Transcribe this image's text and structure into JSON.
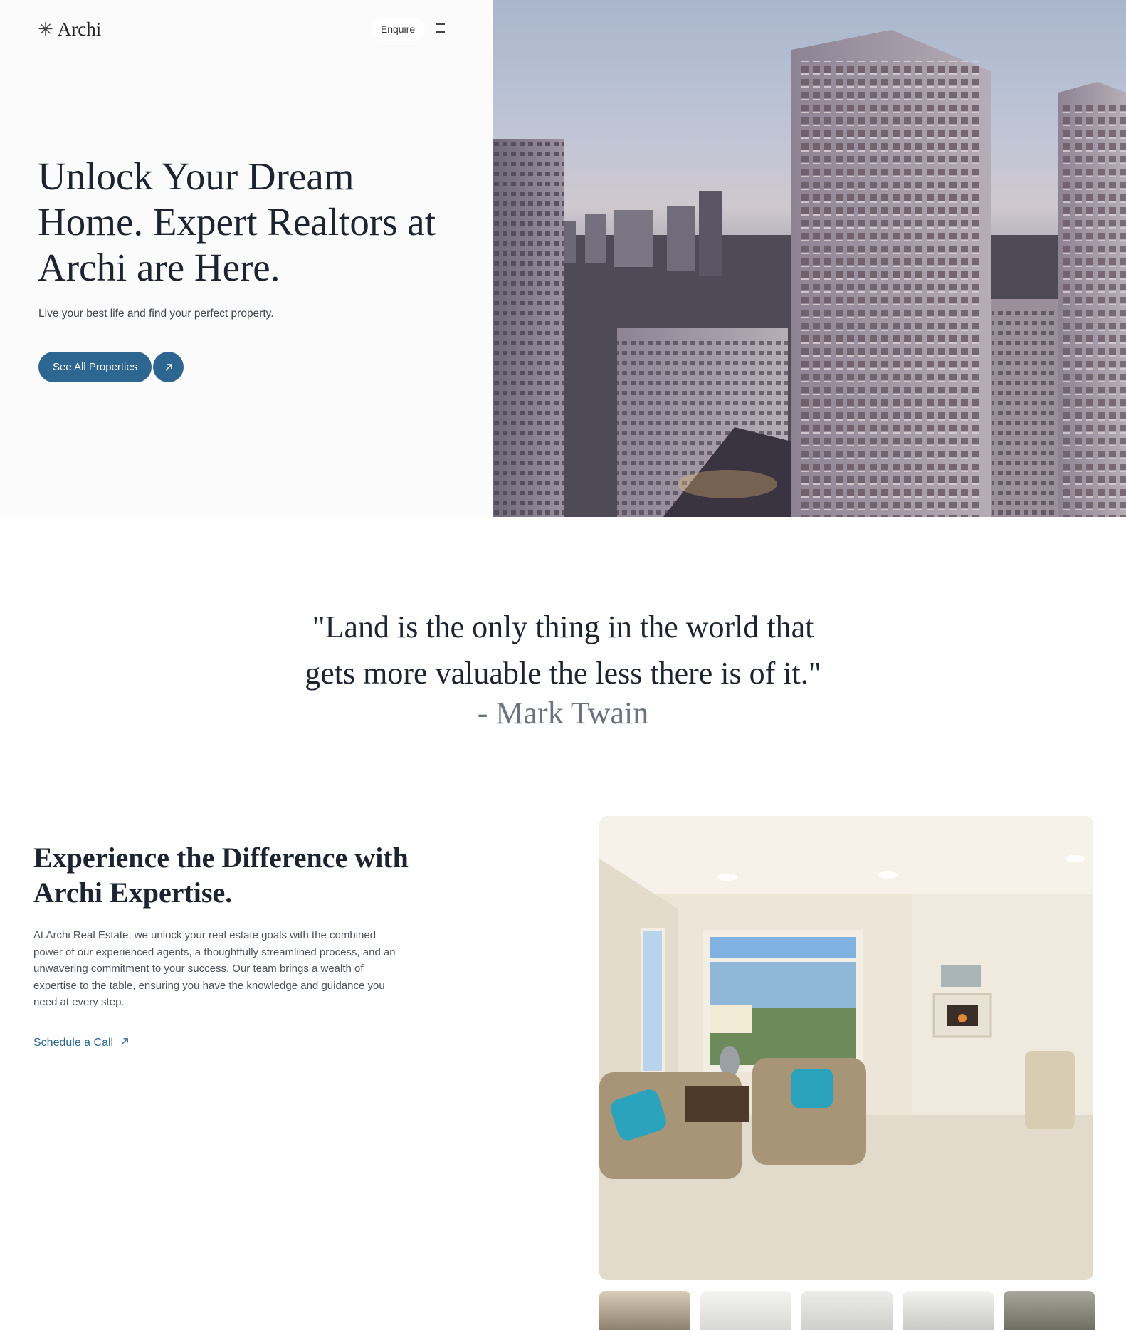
{
  "brand": {
    "name": "Archi",
    "icon": "asterisk-icon"
  },
  "header": {
    "enquire_label": "Enquire",
    "menu_icon": "menu-icon"
  },
  "hero": {
    "title": "Unlock Your Dream Home. Expert Realtors at Archi are Here.",
    "subtitle": "Live your best life and find your perfect property.",
    "cta_label": "See All Properties",
    "cta_icon": "arrow-up-right-icon"
  },
  "quote": {
    "line1": "\"Land is the only thing in the world that",
    "line2": "gets more valuable the less there is of it.\"",
    "author": "- Mark Twain"
  },
  "expertise": {
    "title": "Experience the Difference with Archi Expertise.",
    "body": "At Archi Real Estate, we unlock your real estate goals with the combined power of our experienced agents, a thoughtfully streamlined process, and an unwavering commitment to your success. Our team brings a wealth of expertise to the table, ensuring you have the knowledge and guidance you need at every step.",
    "link_label": "Schedule a Call",
    "link_icon": "arrow-up-right-icon"
  },
  "colors": {
    "accent": "#2d6690",
    "text_dark": "#1b2430",
    "text_muted": "#6c7380",
    "hero_panel_bg": "#fbfbfb"
  }
}
